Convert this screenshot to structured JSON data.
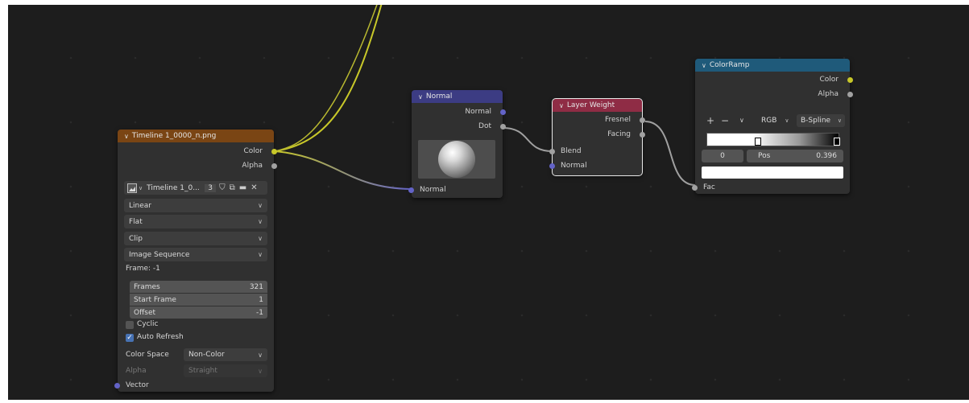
{
  "nodes": {
    "image": {
      "title": "Timeline 1_0000_n.png",
      "outputs": {
        "color": "Color",
        "alpha": "Alpha"
      },
      "image_name": "Timeline 1_0...",
      "users": "3",
      "interpolation": "Linear",
      "projection": "Flat",
      "extension": "Clip",
      "source": "Image Sequence",
      "frame_label": "Frame: -1",
      "frames_label": "Frames",
      "frames_value": "321",
      "start_frame_label": "Start Frame",
      "start_frame_value": "1",
      "offset_label": "Offset",
      "offset_value": "-1",
      "cyclic_label": "Cyclic",
      "auto_refresh_label": "Auto Refresh",
      "colorspace_label": "Color Space",
      "colorspace_value": "Non-Color",
      "alpha_label": "Alpha",
      "alpha_value": "Straight",
      "vector_label": "Vector",
      "header_color": "#7a4514"
    },
    "normal": {
      "title": "Normal",
      "outputs": {
        "normal": "Normal",
        "dot": "Dot"
      },
      "input": "Normal",
      "header_color": "#3c3c83"
    },
    "layer_weight": {
      "title": "Layer Weight",
      "outputs": {
        "fresnel": "Fresnel",
        "facing": "Facing"
      },
      "inputs": {
        "blend": "Blend",
        "normal": "Normal"
      },
      "header_color": "#8f2c45"
    },
    "colorramp": {
      "title": "ColorRamp",
      "outputs": {
        "color": "Color",
        "alpha": "Alpha"
      },
      "mode": "RGB",
      "interpolation": "B-Spline",
      "stop_index": "0",
      "pos_label": "Pos",
      "pos_value": "0.396",
      "input": "Fac",
      "header_color": "#1f5a7a"
    }
  },
  "colors": {
    "socket_color": "#c7c729",
    "socket_gray": "#a1a1a1",
    "socket_vector": "#6363c7",
    "link_yellow": "#c8c829",
    "link_gray": "#a0a0a0",
    "link_blue": "#6363c7"
  }
}
